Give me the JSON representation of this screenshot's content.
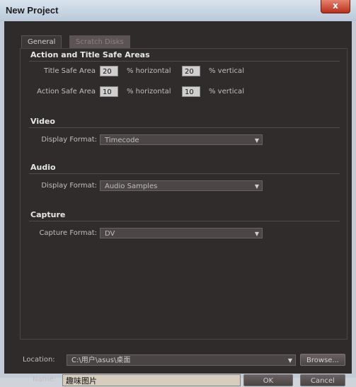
{
  "window": {
    "title": "New Project",
    "close_label": "x"
  },
  "tabs": [
    {
      "label": "General"
    },
    {
      "label": "Scratch Disks"
    }
  ],
  "safe_areas": {
    "heading": "Action and Title Safe Areas",
    "title_label": "Title Safe Area",
    "title_h_value": "20",
    "title_h_unit": "% horizontal",
    "title_v_value": "20",
    "title_v_unit": "% vertical",
    "action_label": "Action Safe Area",
    "action_h_value": "10",
    "action_h_unit": "% horizontal",
    "action_v_value": "10",
    "action_v_unit": "% vertical"
  },
  "video": {
    "heading": "Video",
    "label": "Display Format:",
    "value": "Timecode"
  },
  "audio": {
    "heading": "Audio",
    "label": "Display Format:",
    "value": "Audio Samples"
  },
  "capture": {
    "heading": "Capture",
    "label": "Capture Format:",
    "value": "DV"
  },
  "footer": {
    "location_label": "Location:",
    "location_value": "C:\\用户\\asus\\桌面",
    "browse_label": "Browse...",
    "name_label": "Name:",
    "name_value": "趣味图片",
    "ok_label": "OK",
    "cancel_label": "Cancel"
  },
  "icons": {
    "dropdown": "chevron-down-icon",
    "close": "close-icon"
  }
}
